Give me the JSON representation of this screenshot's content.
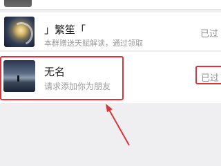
{
  "contacts": [
    {
      "name": "」繁笙「",
      "message": "本群赠送天赋解读，通过领取",
      "status": "已过"
    },
    {
      "name": "无名",
      "message": "请求添加你为朋友",
      "status": "已过"
    }
  ],
  "colors": {
    "annotation": "#d9343b",
    "background": "#efeff1"
  }
}
